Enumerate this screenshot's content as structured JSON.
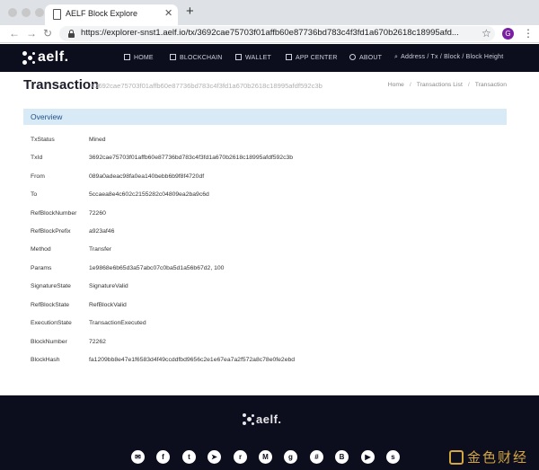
{
  "browser": {
    "tab_title": "AELF Block Explore",
    "url": "https://explorer-snst1.aelf.io/tx/3692cae75703f01affb60e87736bd783c4f3fd1a670b2618c18995afd...",
    "profile_initial": "G"
  },
  "site": {
    "logo_text": "aelf.",
    "nav": [
      {
        "label": "HOME",
        "icon": "home-icon"
      },
      {
        "label": "BLOCKCHAIN",
        "icon": "blockchain-icon"
      },
      {
        "label": "WALLET",
        "icon": "wallet-icon"
      },
      {
        "label": "APP CENTER",
        "icon": "app-center-icon"
      },
      {
        "label": "ABOUT",
        "icon": "about-icon"
      }
    ],
    "search_label": "Address / Tx / Block / Block Height"
  },
  "page": {
    "title": "Transaction",
    "hash": "#3692cae75703f01affb60e87736bd783c4f3fd1a670b2618c18995afdf592c3b",
    "breadcrumb": [
      "Home",
      "Transactions List",
      "Transaction"
    ]
  },
  "overview": {
    "title": "Overview",
    "rows": [
      {
        "label": "TxStatus",
        "value": "Mined"
      },
      {
        "label": "TxId",
        "value": "3692cae75703f01affb60e87736bd783c4f3fd1a670b2618c18995afdf592c3b"
      },
      {
        "label": "From",
        "value": "089a0adeac98fa0ea140bebb6b9f8f4720df"
      },
      {
        "label": "To",
        "value": "5ccaea8e4c602c2155282c04809ea2ba9c6d"
      },
      {
        "label": "RefBlockNumber",
        "value": "72260"
      },
      {
        "label": "RefBlockPrefix",
        "value": "a923af46"
      },
      {
        "label": "Method",
        "value": "Transfer"
      },
      {
        "label": "Params",
        "value": "1e9868e6b65d3a57abc07c0ba5d1a56b67d2, 100"
      },
      {
        "label": "SignatureState",
        "value": "SignatureValid"
      },
      {
        "label": "RefBlockState",
        "value": "RefBlockValid"
      },
      {
        "label": "ExecutionState",
        "value": "TransactionExecuted"
      },
      {
        "label": "BlockNumber",
        "value": "72262"
      },
      {
        "label": "BlockHash",
        "value": "fa1209bb8e47e1f6583d4f49ccddfbd9656c2e1e67ea7a2f572a8c78e0fe2ebd"
      }
    ]
  },
  "footer": {
    "logo_text": "aelf.",
    "social": [
      {
        "name": "email-icon",
        "glyph": "✉"
      },
      {
        "name": "facebook-icon",
        "glyph": "f"
      },
      {
        "name": "twitter-icon",
        "glyph": "t"
      },
      {
        "name": "telegram-icon",
        "glyph": "➤"
      },
      {
        "name": "reddit-icon",
        "glyph": "r"
      },
      {
        "name": "medium-icon",
        "glyph": "M"
      },
      {
        "name": "github-icon",
        "glyph": "g"
      },
      {
        "name": "slack-icon",
        "glyph": "#"
      },
      {
        "name": "bitcointalk-icon",
        "glyph": "B"
      },
      {
        "name": "youtube-icon",
        "glyph": "▶"
      },
      {
        "name": "steemit-icon",
        "glyph": "s"
      }
    ]
  },
  "watermark": {
    "text": "金色财经"
  },
  "colors": {
    "header_bg": "#0c0d1d",
    "overview_bg": "#d8eaf6",
    "overview_text": "#1f4f86",
    "avatar": "#7b1fa2"
  }
}
